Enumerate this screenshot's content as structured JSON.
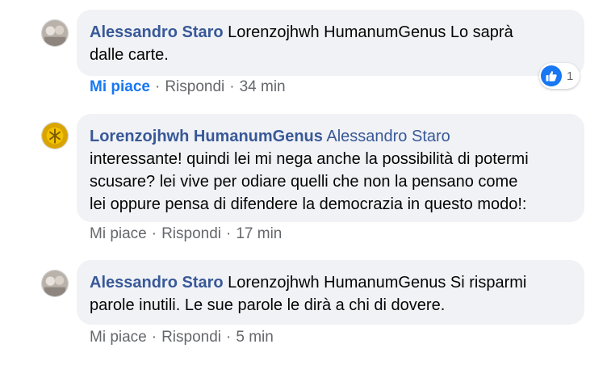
{
  "comments": [
    {
      "author": "Alessandro Staro",
      "text_line1": "Lorenzojhwh HumanumGenus Lo saprà",
      "text_line2": "dalle carte.",
      "like": "Mi piace",
      "reply": "Rispondi",
      "time": "34 min",
      "reaction_count": "1"
    },
    {
      "author": "Lorenzojhwh HumanumGenus",
      "mention": "Alessandro Staro",
      "text_line1": "interessante! quindi lei mi nega anche la possibilità di potermi",
      "text_line2": "scusare? lei vive per odiare quelli che non la pensano come",
      "text_line3": "lei oppure pensa di difendere la democrazia in questo modo!:",
      "like": "Mi piace",
      "reply": "Rispondi",
      "time": "17 min"
    },
    {
      "author": "Alessandro Staro",
      "text_line1": "Lorenzojhwh HumanumGenus Si risparmi",
      "text_line2": "parole inutili. Le sue parole le dirà a chi di dovere.",
      "like": "Mi piace",
      "reply": "Rispondi",
      "time": "5 min"
    }
  ],
  "separator": "·",
  "colors": {
    "author": "#385898",
    "like_active": "#1877f2",
    "bubble": "#f0f2f5",
    "meta": "#65676b"
  },
  "icons": {
    "reaction": "thumbs-up-icon"
  }
}
